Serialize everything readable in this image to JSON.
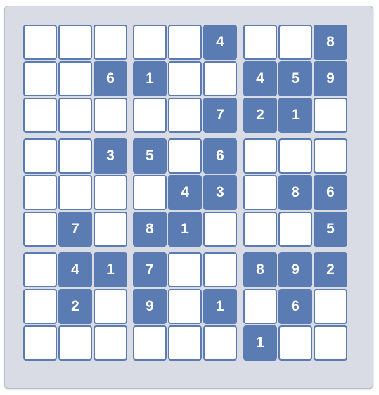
{
  "sudoku": {
    "rows": [
      [
        "",
        "",
        "",
        "",
        "",
        "4",
        "",
        "",
        "8"
      ],
      [
        "",
        "",
        "6",
        "1",
        "",
        "",
        "4",
        "5",
        "9"
      ],
      [
        "",
        "",
        "",
        "",
        "",
        "7",
        "2",
        "1",
        ""
      ],
      [
        "",
        "",
        "3",
        "5",
        "",
        "6",
        "",
        "",
        ""
      ],
      [
        "",
        "",
        "",
        "",
        "4",
        "3",
        "",
        "8",
        "6"
      ],
      [
        "",
        "7",
        "",
        "8",
        "1",
        "",
        "",
        "",
        "5"
      ],
      [
        "",
        "4",
        "1",
        "7",
        "",
        "",
        "8",
        "9",
        "2"
      ],
      [
        "",
        "2",
        "",
        "9",
        "",
        "1",
        "",
        "6",
        ""
      ],
      [
        "",
        "",
        "",
        "",
        "",
        "",
        "1",
        "",
        ""
      ]
    ],
    "colors": {
      "given_cell": "#5b7bb3",
      "empty_cell": "#ffffff",
      "board_background": "#d9dce4",
      "digit": "#ffffff"
    }
  }
}
